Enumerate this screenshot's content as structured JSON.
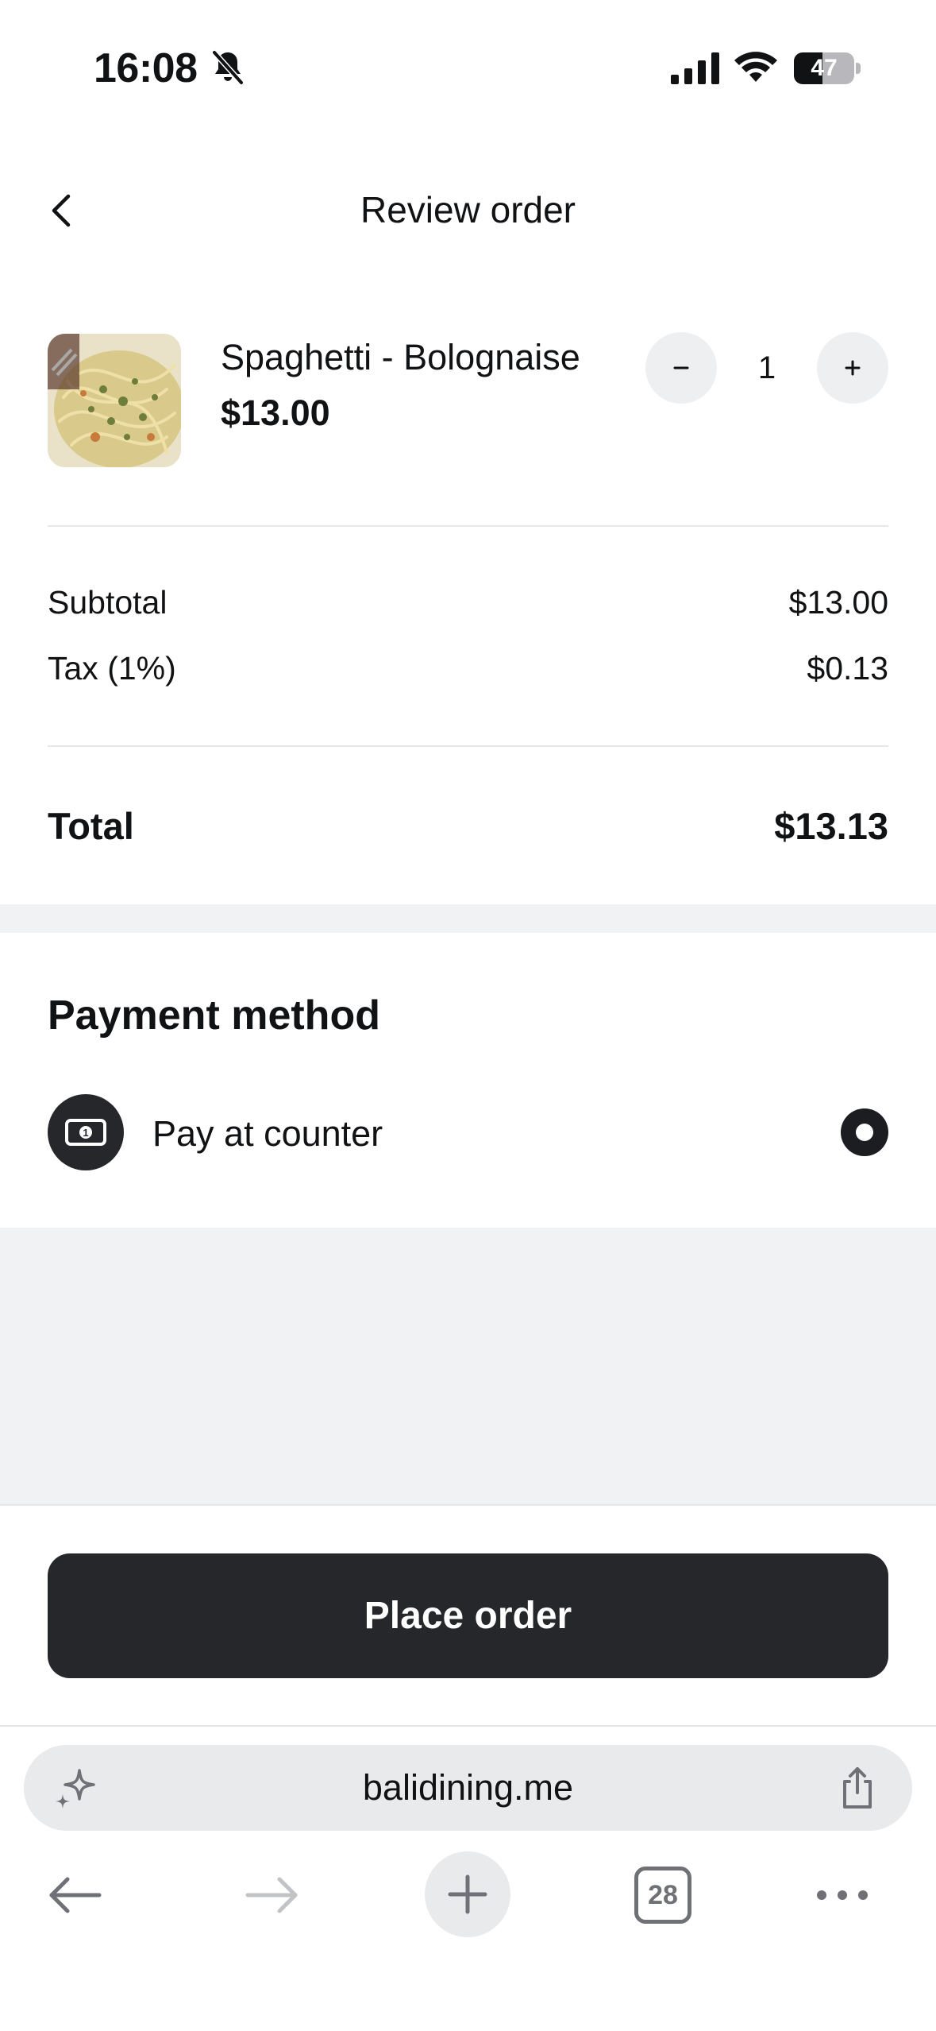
{
  "status_bar": {
    "time": "16:08",
    "battery_level": "47",
    "battery_fraction": 0.47
  },
  "header": {
    "title": "Review order"
  },
  "cart": {
    "items": [
      {
        "name": "Spaghetti - Bolognaise",
        "price": "$13.00",
        "quantity": "1",
        "decrement_label": "−",
        "increment_label": "+"
      }
    ]
  },
  "summary": {
    "subtotal_label": "Subtotal",
    "subtotal_value": "$13.00",
    "tax_label": "Tax (1%)",
    "tax_value": "$0.13",
    "total_label": "Total",
    "total_value": "$13.13"
  },
  "payment": {
    "title": "Payment method",
    "options": [
      {
        "label": "Pay at counter",
        "icon": "cash-icon",
        "selected": true
      }
    ]
  },
  "actions": {
    "place_order_label": "Place order"
  },
  "browser": {
    "url": "balidining.me",
    "tab_count": "28"
  },
  "colors": {
    "primary_dark": "#26272b",
    "background_gray": "#f1f2f4",
    "divider": "#e6e7ea"
  }
}
